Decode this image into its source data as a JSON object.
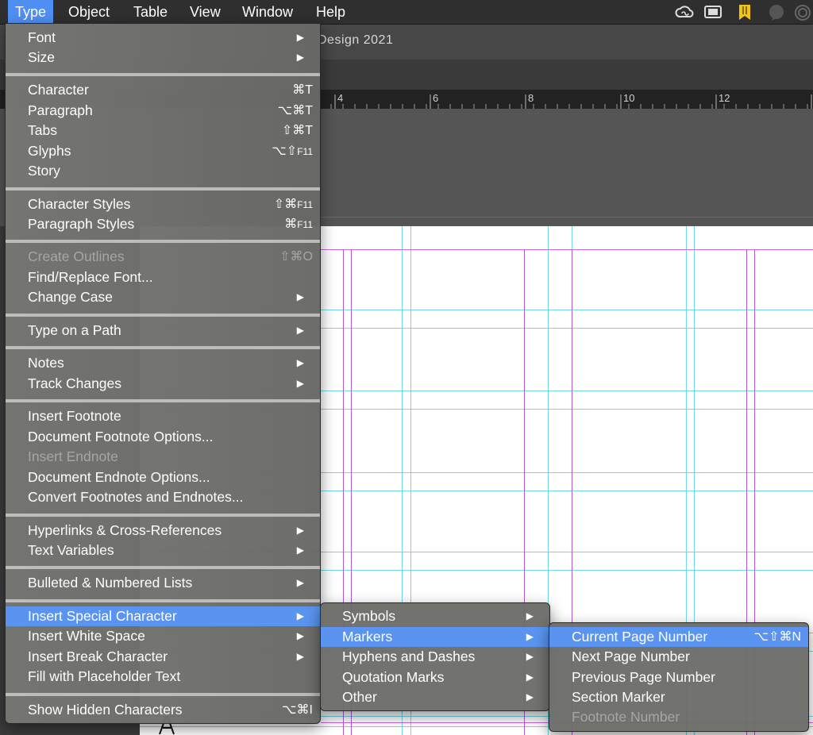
{
  "menubar": {
    "items": [
      "Type",
      "Object",
      "Table",
      "View",
      "Window",
      "Help"
    ],
    "active": "Type",
    "tray_icons": [
      "creative-cloud-icon",
      "display-icon",
      "bookmark-icon",
      "chat-icon",
      "spiral-icon"
    ]
  },
  "document": {
    "title_fragment": "Design 2021",
    "ruler_numbers": [
      "4",
      "6",
      "8",
      "10",
      "12"
    ]
  },
  "type_menu": {
    "items": [
      {
        "label": "Font",
        "submenu": true
      },
      {
        "label": "Size",
        "submenu": true
      },
      {
        "label": "Character",
        "shortcut": "⌘T"
      },
      {
        "label": "Paragraph",
        "shortcut": "⌥⌘T"
      },
      {
        "label": "Tabs",
        "shortcut": "⇧⌘T"
      },
      {
        "label": "Glyphs",
        "shortcut": "⌥⇧",
        "shortcut_small": "F11"
      },
      {
        "label": "Story"
      },
      {
        "label": "Character Styles",
        "shortcut": "⇧⌘",
        "shortcut_small": "F11"
      },
      {
        "label": "Paragraph Styles",
        "shortcut": "⌘",
        "shortcut_small": "F11"
      },
      {
        "label": "Create Outlines",
        "shortcut": "⇧⌘O",
        "disabled": true
      },
      {
        "label": "Find/Replace Font..."
      },
      {
        "label": "Change Case",
        "submenu": true
      },
      {
        "label": "Type on a Path",
        "submenu": true
      },
      {
        "label": "Notes",
        "submenu": true
      },
      {
        "label": "Track Changes",
        "submenu": true
      },
      {
        "label": "Insert Footnote"
      },
      {
        "label": "Document Footnote Options..."
      },
      {
        "label": "Insert Endnote",
        "disabled": true
      },
      {
        "label": "Document Endnote Options..."
      },
      {
        "label": "Convert Footnotes and Endnotes..."
      },
      {
        "label": "Hyperlinks & Cross-References",
        "submenu": true
      },
      {
        "label": "Text Variables",
        "submenu": true
      },
      {
        "label": "Bulleted & Numbered Lists",
        "submenu": true
      },
      {
        "label": "Insert Special Character",
        "submenu": true,
        "highlighted": true
      },
      {
        "label": "Insert White Space",
        "submenu": true
      },
      {
        "label": "Insert Break Character",
        "submenu": true
      },
      {
        "label": "Fill with Placeholder Text"
      },
      {
        "label": "Show Hidden Characters",
        "shortcut": "⌥⌘I"
      }
    ]
  },
  "special_char_menu": {
    "items": [
      {
        "label": "Symbols",
        "submenu": true
      },
      {
        "label": "Markers",
        "submenu": true,
        "highlighted": true
      },
      {
        "label": "Hyphens and Dashes",
        "submenu": true
      },
      {
        "label": "Quotation Marks",
        "submenu": true
      },
      {
        "label": "Other",
        "submenu": true
      }
    ]
  },
  "markers_menu": {
    "items": [
      {
        "label": "Current Page Number",
        "shortcut": "⌥⇧⌘N",
        "highlighted": true
      },
      {
        "label": "Next Page Number"
      },
      {
        "label": "Previous Page Number"
      },
      {
        "label": "Section Marker"
      },
      {
        "label": "Footnote Number",
        "disabled": true
      }
    ]
  },
  "colors": {
    "highlight": "#5a94f0",
    "menubar_active": "#4f8ff3",
    "guide_cyan": "#6fd8e8",
    "guide_magenta": "#b05ad6"
  }
}
